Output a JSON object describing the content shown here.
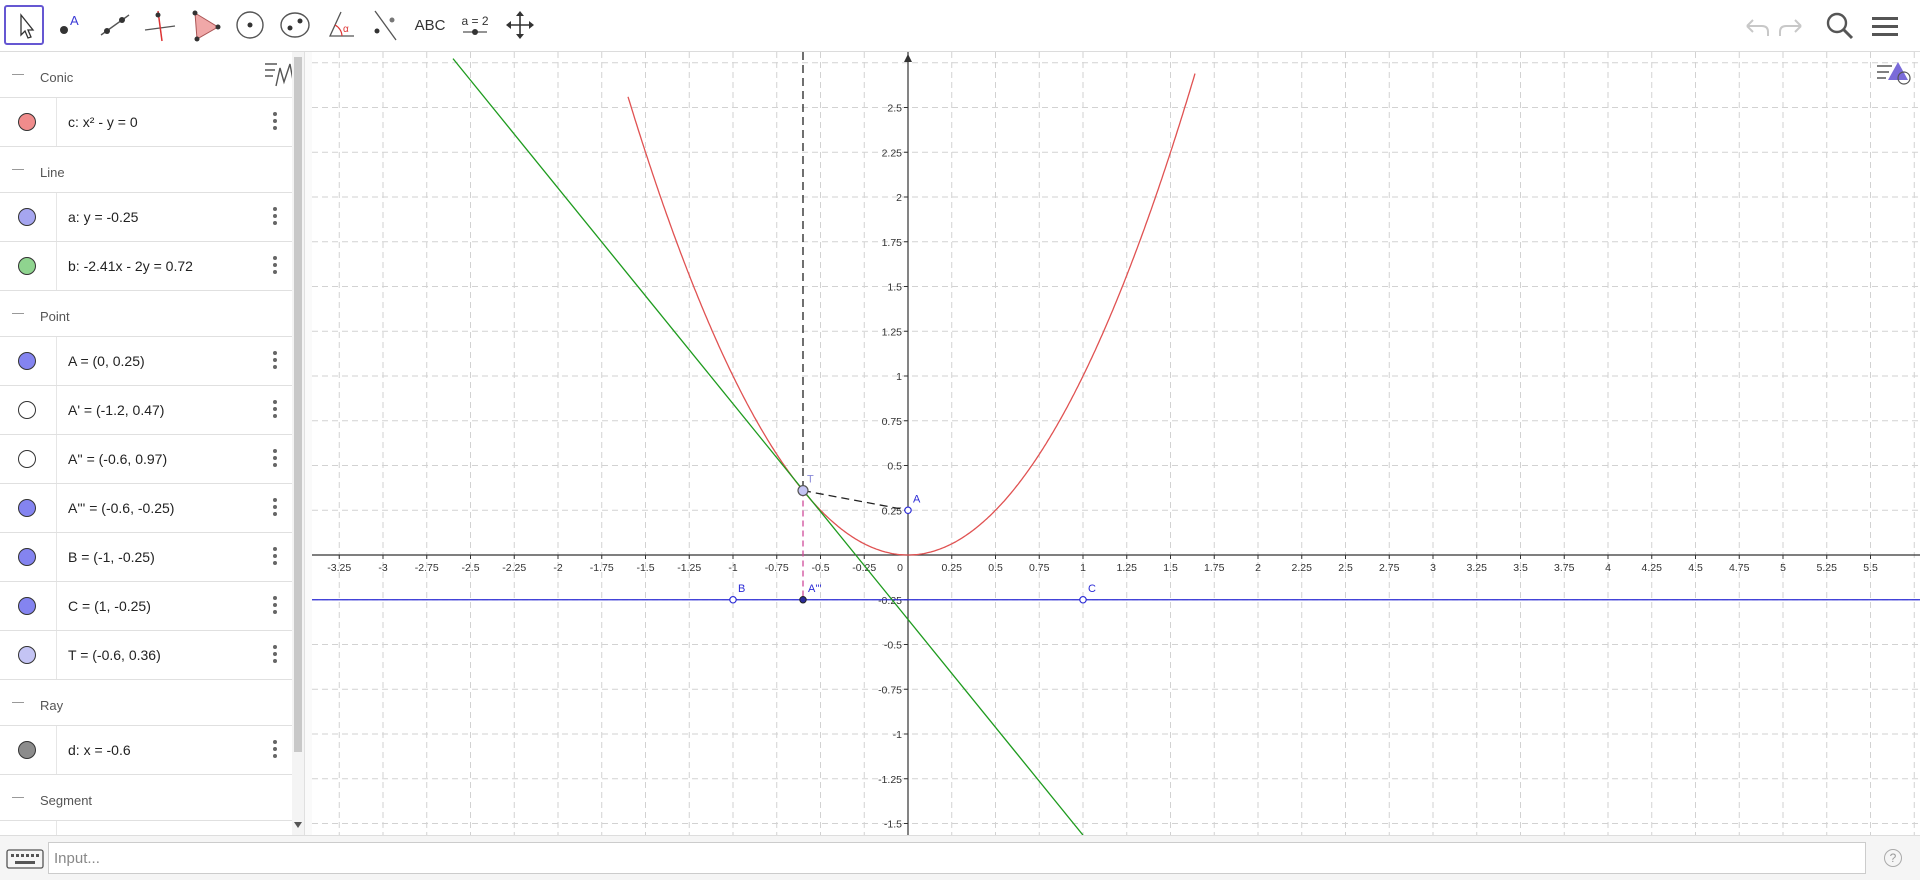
{
  "toolbar": {
    "tools": [
      {
        "name": "move-tool",
        "icon": "arrow-cursor-icon",
        "selected": true
      },
      {
        "name": "point-tool",
        "icon": "point-icon",
        "label": "A"
      },
      {
        "name": "line-tool",
        "icon": "line-icon"
      },
      {
        "name": "perpendicular-line-tool",
        "icon": "perpendicular-icon"
      },
      {
        "name": "polygon-tool",
        "icon": "triangle-icon"
      },
      {
        "name": "circle-tool",
        "icon": "circle-center-icon"
      },
      {
        "name": "ellipse-tool",
        "icon": "ellipse-icon"
      },
      {
        "name": "angle-tool",
        "icon": "angle-icon",
        "label": "α"
      },
      {
        "name": "reflect-tool",
        "icon": "reflect-icon"
      },
      {
        "name": "text-tool",
        "icon": "text-icon",
        "label": "ABC"
      },
      {
        "name": "slider-tool",
        "icon": "slider-icon",
        "label": "a = 2"
      },
      {
        "name": "move-graphics-tool",
        "icon": "move-cross-icon"
      }
    ],
    "undo_icon": "undo-icon",
    "redo_icon": "redo-icon",
    "search_icon": "search-icon",
    "menu_icon": "hamburger-menu-icon"
  },
  "algebra": {
    "groups": [
      {
        "title": "Conic",
        "items": [
          {
            "text": "c: x² - y = 0",
            "color": "#f08c8c",
            "filled": true
          }
        ]
      },
      {
        "title": "Line",
        "items": [
          {
            "text": "a: y = -0.25",
            "color": "#a6a6f0",
            "filled": true
          },
          {
            "text": "b: -2.41x - 2y = 0.72",
            "color": "#8fd48f",
            "filled": true
          }
        ]
      },
      {
        "title": "Point",
        "items": [
          {
            "text": "A = (0, 0.25)",
            "color": "#8484f0",
            "filled": true
          },
          {
            "text": "A' = (-1.2, 0.47)",
            "color": "#ffffff",
            "filled": false
          },
          {
            "text": "A'' = (-0.6, 0.97)",
            "color": "#ffffff",
            "filled": false
          },
          {
            "text": "A''' = (-0.6, -0.25)",
            "color": "#8484f0",
            "filled": true
          },
          {
            "text": "B = (-1, -0.25)",
            "color": "#8484f0",
            "filled": true
          },
          {
            "text": "C = (1, -0.25)",
            "color": "#8484f0",
            "filled": true
          },
          {
            "text": "T = (-0.6, 0.36)",
            "color": "#c4c4f4",
            "filled": true
          }
        ]
      },
      {
        "title": "Ray",
        "items": [
          {
            "text": "d: x = -0.6",
            "color": "#8c8c8c",
            "filled": true
          }
        ]
      },
      {
        "title": "Segment",
        "items": [
          {
            "text": "",
            "color": "#8c8c8c",
            "filled": true
          }
        ]
      }
    ]
  },
  "graphics": {
    "x_ticks": [
      "-3.25",
      "-3",
      "-2.75",
      "-2.5",
      "-2.25",
      "-2",
      "-1.75",
      "-1.5",
      "-1.25",
      "-1",
      "-0.75",
      "-0.5",
      "-0.25",
      "0",
      "0.25",
      "0.5",
      "0.75",
      "1",
      "1.25",
      "1.5",
      "1.75",
      "2",
      "2.25",
      "2.5",
      "2.75",
      "3",
      "3.25",
      "3.5",
      "3.75",
      "4",
      "4.25",
      "4.5",
      "4.75",
      "5",
      "5.25",
      "5.5"
    ],
    "y_ticks": [
      "2.5",
      "2.25",
      "2",
      "1.75",
      "1.5",
      "1.25",
      "1",
      "0.75",
      "0.5",
      "0.25",
      "-0.25",
      "-0.5",
      "-0.75",
      "-1",
      "-1.25",
      "-1.5"
    ],
    "x_tick_values": [
      -3.25,
      -3,
      -2.75,
      -2.5,
      -2.25,
      -2,
      -1.75,
      -1.5,
      -1.25,
      -1,
      -0.75,
      -0.5,
      -0.25,
      0,
      0.25,
      0.5,
      0.75,
      1,
      1.25,
      1.5,
      1.75,
      2,
      2.25,
      2.5,
      2.75,
      3,
      3.25,
      3.5,
      3.75,
      4,
      4.25,
      4.5,
      4.75,
      5,
      5.25,
      5.5
    ],
    "y_tick_values": [
      2.5,
      2.25,
      2,
      1.75,
      1.5,
      1.25,
      1,
      0.75,
      0.5,
      0.25,
      -0.25,
      -0.5,
      -0.75,
      -1,
      -1.25,
      -1.5
    ],
    "parabola_color": "#e05252",
    "tangent_color": "#1e9b1e",
    "directrix_color": "#2b2bd6",
    "point_color": "#2b2bd6",
    "points": [
      {
        "label": "A",
        "x": 0,
        "y": 0.25
      },
      {
        "label": "B",
        "x": -1,
        "y": -0.25
      },
      {
        "label": "C",
        "x": 1,
        "y": -0.25
      },
      {
        "label": "A'''",
        "x": -0.6,
        "y": -0.25
      },
      {
        "label": "T",
        "x": -0.6,
        "y": 0.36
      }
    ]
  },
  "input": {
    "placeholder": "Input...",
    "keyboard_icon": "keyboard-icon",
    "help_label": "?"
  }
}
